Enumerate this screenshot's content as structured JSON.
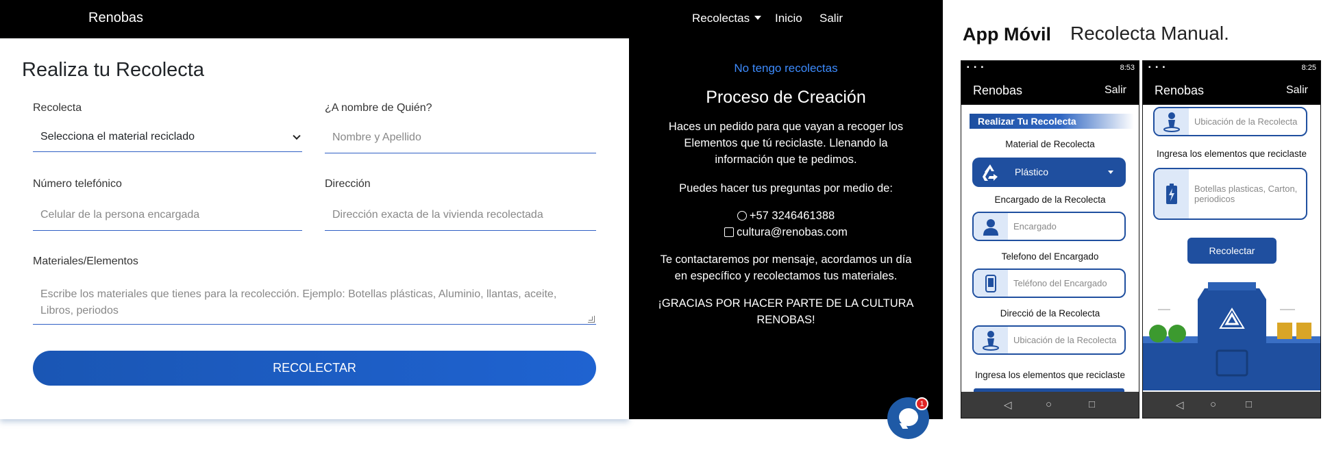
{
  "web": {
    "brand": "Renobas",
    "nav": {
      "recolectas": "Recolectas",
      "inicio": "Inicio",
      "salir": "Salir"
    },
    "form": {
      "title": "Realiza tu Recolecta",
      "recolecta_label": "Recolecta",
      "recolecta_value": "Selecciona el material reciclado",
      "nombre_label": "¿A nombre de Quién?",
      "nombre_placeholder": "Nombre y Apellido",
      "telefono_label": "Número telefónico",
      "telefono_placeholder": "Celular de la persona encargada",
      "direccion_label": "Dirección",
      "direccion_placeholder": "Dirección exacta de la vivienda recolectada",
      "materiales_label": "Materiales/Elementos",
      "materiales_placeholder": "Escribe los materiales que tienes para la recolección. Ejemplo: Botellas plásticas, Aluminio, llantas, aceite, Libros, periodos",
      "submit": "RECOLECTAR"
    },
    "info": {
      "link": "No tengo recolectas",
      "title": "Proceso de Creación",
      "p1": "Haces un pedido para que vayan a recoger los Elementos que tú reciclaste. Llenando la información que te pedimos.",
      "p2": "Puedes hacer tus preguntas por medio de:",
      "phone": "+57 3246461388",
      "email": "cultura@renobas.com",
      "p3": "Te contactaremos por mensaje, acordamos un día en específico y recolectamos tus materiales.",
      "p4": "¡GRACIAS POR HACER PARTE DE LA CULTURA RENOBAS!"
    },
    "chat_badge": "1"
  },
  "mobile": {
    "title_bold": "App Móvil",
    "title_light": "Recolecta Manual.",
    "phone1": {
      "time": "8:53",
      "brand": "Renobas",
      "exit": "Salir",
      "banner": "Realizar Tu Recolecta",
      "material_label": "Material de Recolecta",
      "material_value": "Plástico",
      "encargado_label": "Encargado de la Recolecta",
      "encargado_placeholder": "Encargado",
      "telefono_label": "Telefono del Encargado",
      "telefono_placeholder": "Teléfono del Encargado",
      "direccion_label": "Direcció de la Recolecta",
      "direccion_placeholder": "Ubicación de la Recolecta",
      "elementos_label": "Ingresa los elementos que reciclaste"
    },
    "phone2": {
      "time": "8:25",
      "brand": "Renobas",
      "exit": "Salir",
      "ubicacion_placeholder": "Ubicación de la Recolecta",
      "elementos_label": "Ingresa los elementos que reciclaste",
      "elementos_placeholder": "Botellas plasticas, Carton, periodicos",
      "submit": "Recolectar"
    }
  },
  "colors": {
    "accent_blue": "#1f4f9f",
    "link_blue": "#3d8bfd",
    "nav_black": "#000000",
    "bag_green": "#3c9a2f"
  }
}
